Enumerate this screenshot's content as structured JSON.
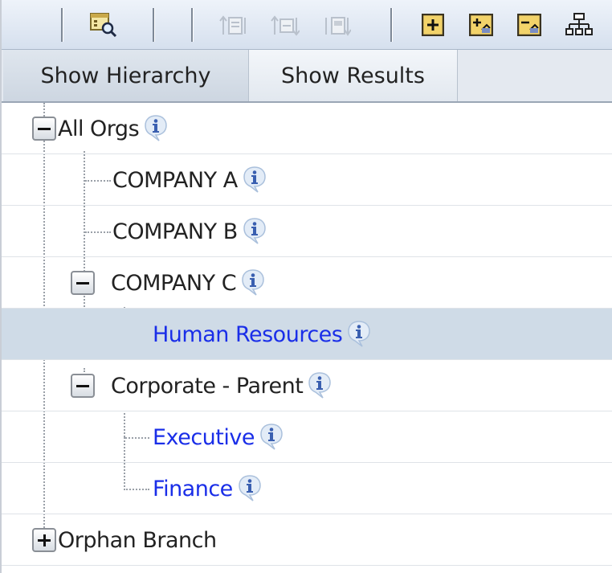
{
  "tabs": {
    "show_hierarchy": "Show Hierarchy",
    "show_results": "Show Results"
  },
  "toolbar": {
    "buttons": [
      {
        "icon": "find-icon",
        "enabled": true
      },
      {
        "icon": "move-up-icon",
        "enabled": false
      },
      {
        "icon": "move-across-icon",
        "enabled": false
      },
      {
        "icon": "move-down-icon",
        "enabled": false
      },
      {
        "icon": "expand-icon",
        "enabled": true
      },
      {
        "icon": "expand-all-icon",
        "enabled": true
      },
      {
        "icon": "collapse-all-icon",
        "enabled": true
      },
      {
        "icon": "org-chart-icon",
        "enabled": true
      }
    ]
  },
  "tree": {
    "all_orgs": "All Orgs",
    "company_a": "COMPANY A",
    "company_b": "COMPANY B",
    "company_c": "COMPANY C",
    "human_resources": "Human Resources",
    "corporate_parent": "Corporate - Parent",
    "executive": "Executive",
    "finance": "Finance",
    "orphan_branch": "Orphan Branch"
  },
  "colors": {
    "link": "#1a2ee8",
    "selected_row": "#cfdbe7",
    "toolbar_top": "#eef3fa",
    "toolbar_bottom": "#d6e0ee"
  }
}
